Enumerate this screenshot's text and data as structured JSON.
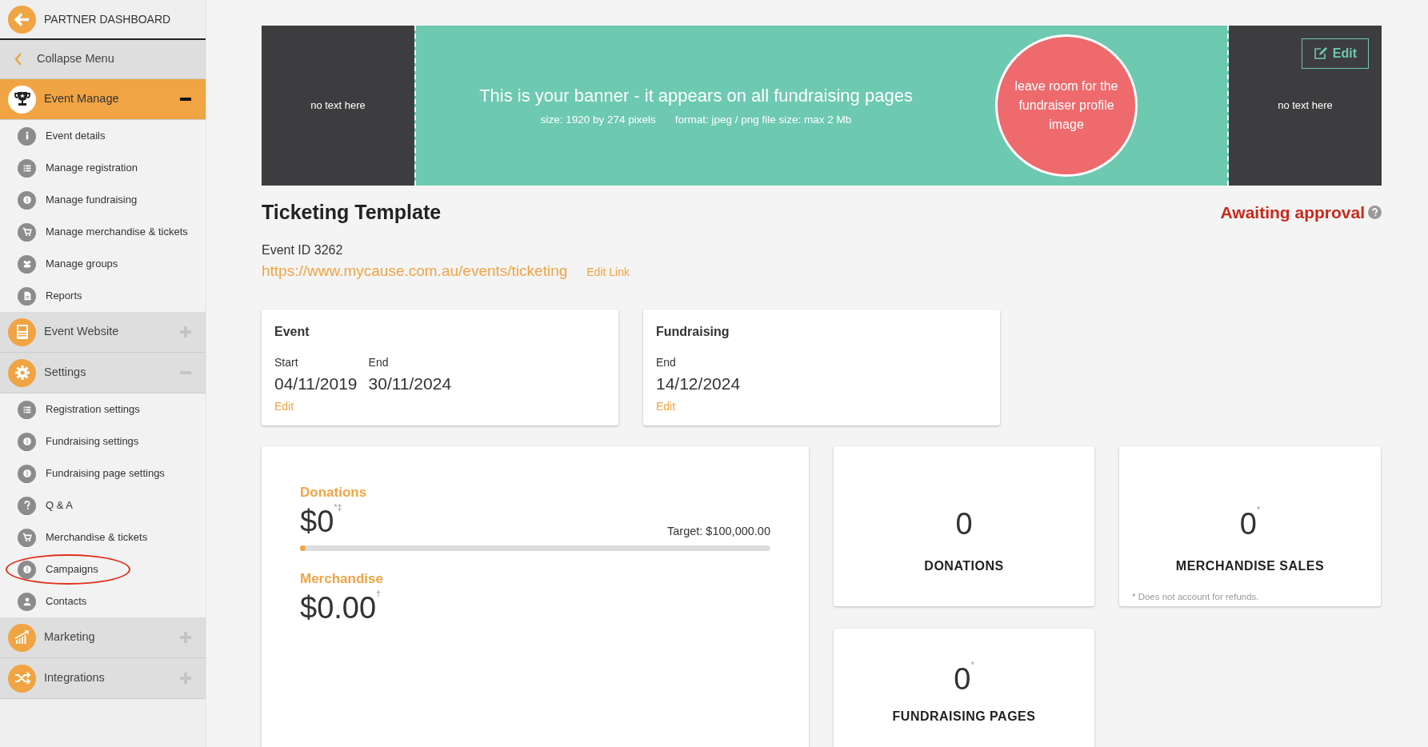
{
  "sidebar": {
    "header": {
      "title": "PARTNER DASHBOARD"
    },
    "collapse": {
      "label": "Collapse Menu"
    },
    "sections": [
      {
        "label": "Event Manage",
        "selected": true,
        "expanded": true,
        "items": [
          {
            "label": "Event details",
            "circled": false
          },
          {
            "label": "Manage registration",
            "circled": false
          },
          {
            "label": "Manage fundraising",
            "circled": false
          },
          {
            "label": "Manage merchandise & tickets",
            "circled": false
          },
          {
            "label": "Manage groups",
            "circled": false
          },
          {
            "label": "Reports",
            "circled": false
          }
        ]
      },
      {
        "label": "Event Website",
        "selected": false,
        "expanded": false
      },
      {
        "label": "Settings",
        "selected": false,
        "expanded": true,
        "items": [
          {
            "label": "Registration settings",
            "circled": false
          },
          {
            "label": "Fundraising settings",
            "circled": false
          },
          {
            "label": "Fundraising page settings",
            "circled": false
          },
          {
            "label": "Q & A",
            "circled": false
          },
          {
            "label": "Merchandise & tickets",
            "circled": false
          },
          {
            "label": "Campaigns",
            "circled": true
          },
          {
            "label": "Contacts",
            "circled": false
          }
        ]
      },
      {
        "label": "Marketing",
        "selected": false,
        "expanded": false
      },
      {
        "label": "Integrations",
        "selected": false,
        "expanded": false
      }
    ]
  },
  "banner": {
    "left_note": "no text here",
    "headline": "This is your banner - it appears on all fundraising pages",
    "size_note": "size: 1920 by 274 pixels",
    "format_note": "format: jpeg / png file size: max 2 Mb",
    "profile_note": "leave room for the fundraiser profile image",
    "right_note": "no text here",
    "edit_button": "Edit"
  },
  "event": {
    "title": "Ticketing Template",
    "status": "Awaiting approval",
    "event_id": "Event ID 3262",
    "url": "https://www.mycause.com.au/events/ticketing",
    "edit_link": "Edit Link"
  },
  "date_cards": [
    {
      "title": "Event",
      "dates": [
        {
          "label": "Start",
          "value": "04/11/2019"
        },
        {
          "label": "End",
          "value": "30/11/2024"
        }
      ],
      "edit": "Edit"
    },
    {
      "title": "Fundraising",
      "dates": [
        {
          "label": "End",
          "value": "14/12/2024"
        }
      ],
      "edit": "Edit"
    }
  ],
  "totals": {
    "donations": {
      "label": "Donations",
      "value": "$0",
      "mark": "*‡",
      "target": "Target: $100,000.00",
      "level": 0
    },
    "merchandise": {
      "label": "Merchandise",
      "value": "$0.00",
      "mark": "†"
    }
  },
  "stats": [
    {
      "value": "0",
      "label": "DONATIONS"
    },
    {
      "value": "0",
      "mark": "*",
      "label": "MERCHANDISE SALES",
      "footnote": "* Does not account for refunds."
    },
    {
      "value": "0",
      "mark": "*",
      "label": "FUNDRAISING PAGES"
    }
  ]
}
